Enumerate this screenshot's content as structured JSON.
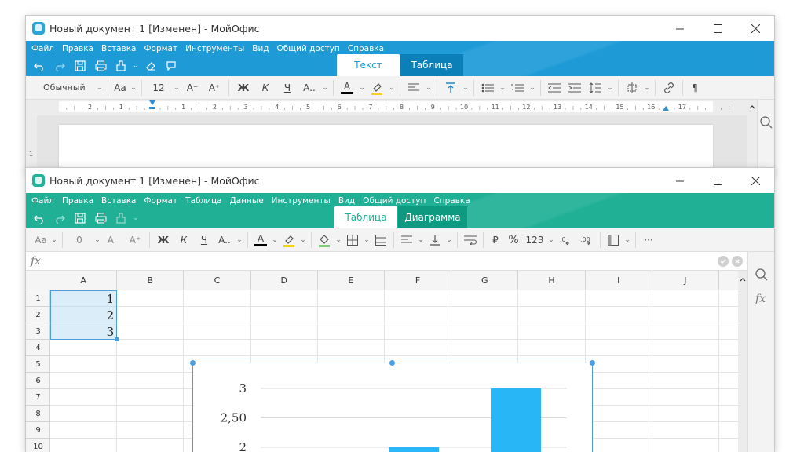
{
  "writer": {
    "title": "Новый документ 1 [Изменен] - МойОфис",
    "logo_color": "#2aa5d8",
    "accent": "#1e9bd7",
    "menu": [
      "Файл",
      "Правка",
      "Вставка",
      "Формат",
      "Инструменты",
      "Вид",
      "Общий доступ",
      "Справка"
    ],
    "tabs": [
      {
        "label": "Текст",
        "active": true
      },
      {
        "label": "Таблица",
        "active": false
      }
    ],
    "toolbar": {
      "style": "Обычный",
      "font": "Aa",
      "size": "12",
      "decrease": "A⁻",
      "increase": "A⁺",
      "bold": "Ж",
      "italic": "К",
      "underline": "Ч",
      "more_text": "A..",
      "font_color_glyph": "A"
    },
    "ruler_labels": [
      "2",
      "1",
      "1",
      "2",
      "3",
      "4",
      "5",
      "6",
      "7",
      "8",
      "9",
      "10",
      "11",
      "12",
      "13",
      "14",
      "15",
      "16",
      "17"
    ],
    "vruler_label": "1"
  },
  "calc": {
    "title": "Новый документ 1 [Изменен] - МойОфис",
    "logo_color": "#21b39a",
    "accent": "#1fb096",
    "menu": [
      "Файл",
      "Правка",
      "Вставка",
      "Формат",
      "Таблица",
      "Данные",
      "Инструменты",
      "Вид",
      "Общий доступ",
      "Справка"
    ],
    "tabs": [
      {
        "label": "Таблица",
        "active": true
      },
      {
        "label": "Диаграмма",
        "active": false
      }
    ],
    "toolbar": {
      "font": "Aa",
      "size": "0",
      "decrease": "A⁻",
      "increase": "A⁺",
      "bold": "Ж",
      "italic": "К",
      "underline": "Ч",
      "more_text": "A..",
      "font_color_glyph": "A",
      "currency": "₽",
      "percent": "%",
      "number": "123",
      "more": "···"
    },
    "formula_label": "fx",
    "columns": [
      "A",
      "B",
      "C",
      "D",
      "E",
      "F",
      "G",
      "H",
      "I",
      "J"
    ],
    "rows": [
      "1",
      "2",
      "3",
      "4",
      "5",
      "6",
      "7",
      "8",
      "9",
      "10"
    ],
    "cells": {
      "A1": "1",
      "A2": "2",
      "A3": "3"
    },
    "side_fx": "fx"
  },
  "chart_data": {
    "type": "bar",
    "categories": [
      "",
      "",
      ""
    ],
    "values": [
      1,
      2,
      3
    ],
    "ylim": [
      1,
      3
    ],
    "yticks": [
      "3",
      "2,50",
      "2"
    ],
    "color": "#29b6f6"
  }
}
